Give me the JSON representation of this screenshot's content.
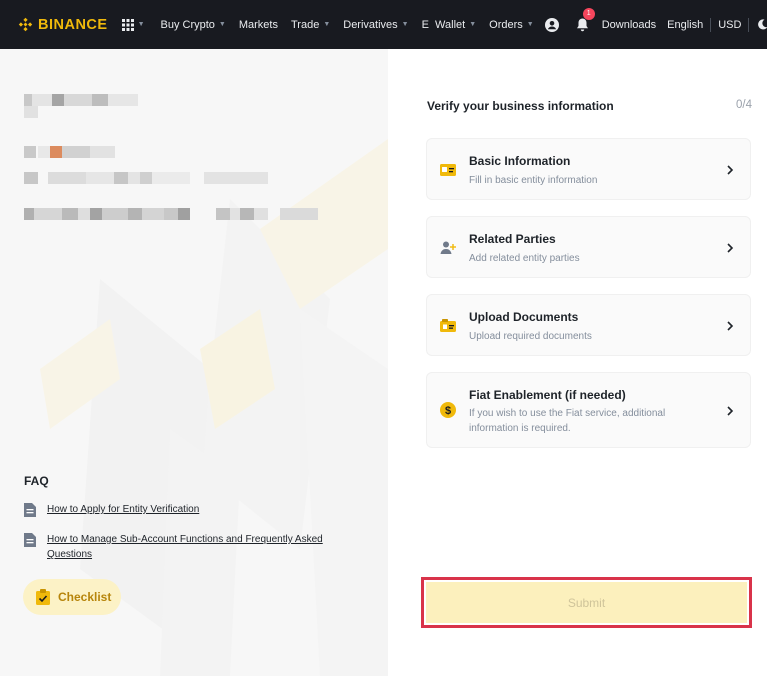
{
  "brand": {
    "name": "BINANCE",
    "color": "#f0b90b"
  },
  "nav": {
    "items": [
      {
        "label": "Buy Crypto",
        "dropdown": true
      },
      {
        "label": "Markets",
        "dropdown": false
      },
      {
        "label": "Trade",
        "dropdown": true
      },
      {
        "label": "Derivatives",
        "dropdown": true
      },
      {
        "label": "E  Wallet",
        "dropdown": true
      },
      {
        "label": "Orders",
        "dropdown": true
      }
    ],
    "notification_count": "1",
    "downloads": "Downloads",
    "language": "English",
    "currency": "USD"
  },
  "faq": {
    "title": "FAQ",
    "items": [
      "How to Apply for Entity Verification",
      "How to Manage Sub-Account Functions and Frequently Asked Questions"
    ]
  },
  "checklist_label": "Checklist",
  "verify": {
    "title": "Verify your business information",
    "progress": "0/4",
    "steps": [
      {
        "title": "Basic Information",
        "subtitle": "Fill in basic entity information",
        "icon": "id-card-icon"
      },
      {
        "title": "Related Parties",
        "subtitle": "Add related entity parties",
        "icon": "add-user-icon"
      },
      {
        "title": "Upload Documents",
        "subtitle": "Upload required documents",
        "icon": "document-upload-icon"
      },
      {
        "title": "Fiat Enablement (if needed)",
        "subtitle": "If you wish to use the Fiat service, additional information is required.",
        "icon": "dollar-coin-icon"
      }
    ]
  },
  "submit_label": "Submit",
  "colors": {
    "accent": "#f0b90b",
    "topbar": "#181a20",
    "highlight": "#d9334a"
  }
}
